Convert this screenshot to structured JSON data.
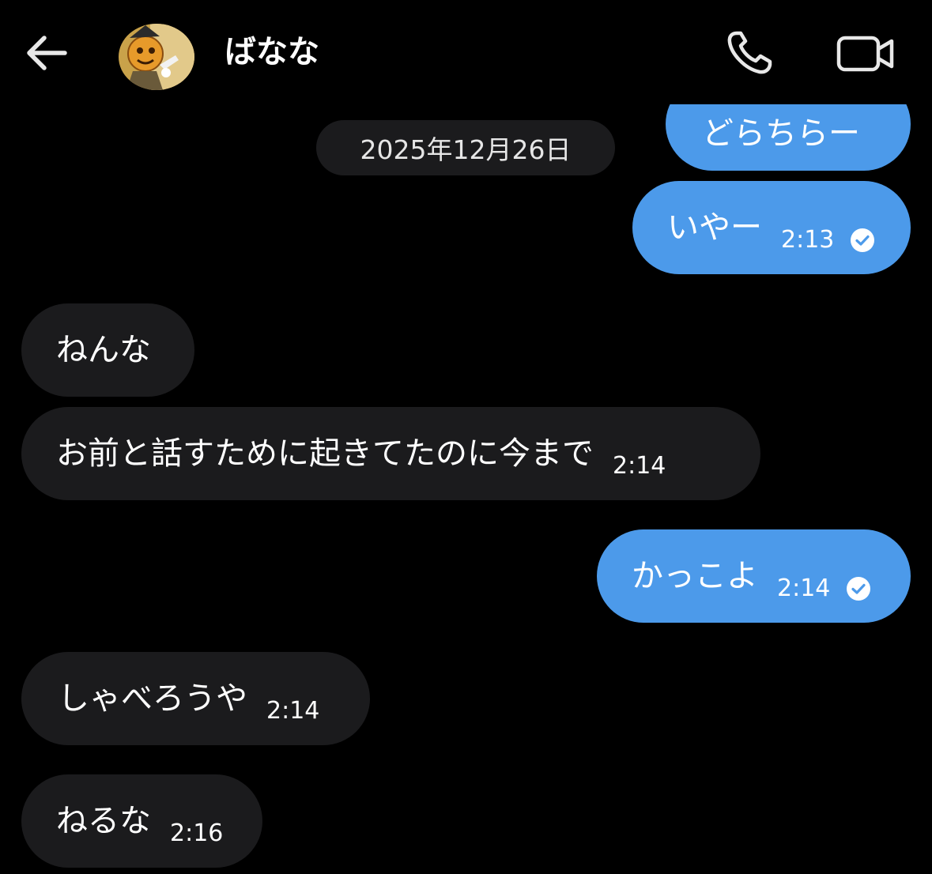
{
  "header": {
    "back_icon": "arrow-left-icon",
    "contact_name": "ばなな",
    "call_icon": "phone-icon",
    "video_icon": "video-camera-icon"
  },
  "date_divider": "2025年12月26日",
  "messages": [
    {
      "direction": "outgoing",
      "text": "どらちらー",
      "time": "",
      "read": false
    },
    {
      "direction": "outgoing",
      "text": "いやー",
      "time": "2:13",
      "read": true
    },
    {
      "direction": "incoming",
      "text": "ねんな",
      "time": ""
    },
    {
      "direction": "incoming",
      "text": "お前と話すために起きてたのに今まで",
      "time": "2:14"
    },
    {
      "direction": "outgoing",
      "text": "かっこよ",
      "time": "2:14",
      "read": true
    },
    {
      "direction": "incoming",
      "text": "しゃべろうや",
      "time": "2:14"
    },
    {
      "direction": "incoming",
      "text": "ねるな",
      "time": "2:16"
    }
  ],
  "colors": {
    "background": "#000000",
    "outgoing_bubble": "#4c9aea",
    "incoming_bubble": "#1b1b1d",
    "text": "#ffffff"
  }
}
